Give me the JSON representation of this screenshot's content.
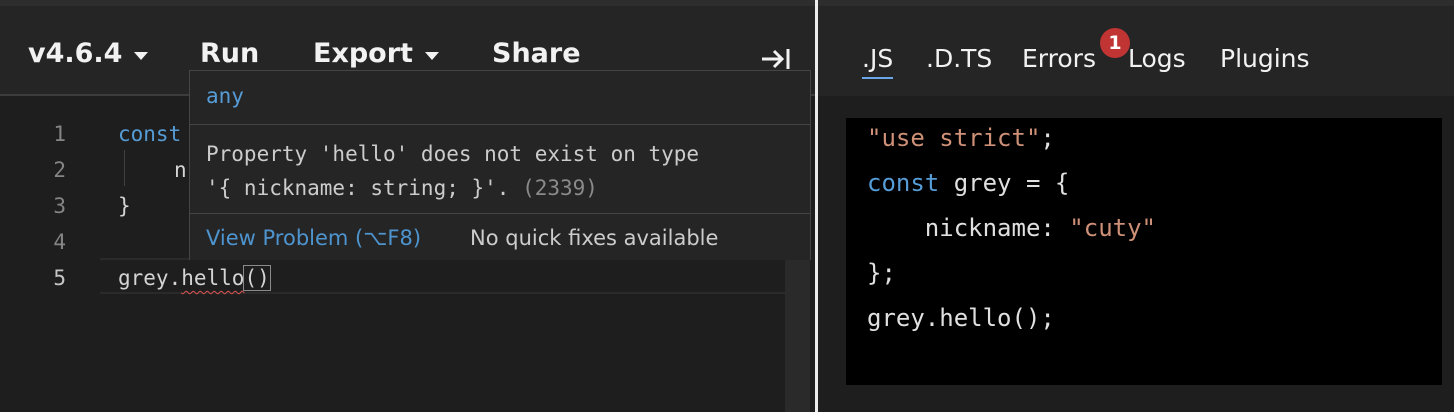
{
  "toolbar": {
    "version": "v4.6.4",
    "run": "Run",
    "export": "Export",
    "share": "Share",
    "collapse_icon": "collapse-right-icon"
  },
  "editor": {
    "line_numbers": [
      "1",
      "2",
      "3",
      "4",
      "5"
    ],
    "lines": {
      "l1_kw": "const",
      "l2": "n",
      "l3": "}",
      "l5_a": "grey.",
      "l5_b": "hello",
      "l5_c": "()"
    }
  },
  "hover": {
    "type": "any",
    "message_line1": "Property 'hello' does not exist on type",
    "message_line2": "'{ nickname: string; }'.",
    "error_code": "(2339)",
    "view_problem": "View Problem (⌥F8)",
    "no_fixes": "No quick fixes available"
  },
  "sidebar_tabs": {
    "js": ".JS",
    "dts": ".D.TS",
    "errors": "Errors",
    "errors_badge": "1",
    "logs": "Logs",
    "plugins": "Plugins"
  },
  "output": {
    "l1_str": "\"use strict\"",
    "l1_end": ";",
    "l2_kw": "const",
    "l2_rest": " grey = {",
    "l3_a": "    nickname: ",
    "l3_str": "\"cuty\"",
    "l4": "};",
    "l5": "grey.hello();"
  },
  "colors": {
    "keyword": "#569cd6",
    "string": "#ce9178",
    "error": "#c03434",
    "link": "#4e94ce"
  }
}
